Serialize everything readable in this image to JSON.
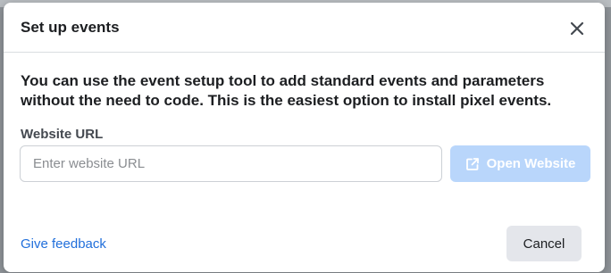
{
  "dialog": {
    "title": "Set up events",
    "description": "You can use the event setup tool to add standard events and parameters without the need to code. This is the easiest option to install pixel events.",
    "url_label": "Website URL",
    "url_placeholder": "Enter website URL",
    "url_value": "",
    "open_button_label": "Open Website",
    "open_button_enabled": false,
    "feedback_link": "Give feedback",
    "cancel_label": "Cancel"
  },
  "icons": {
    "close": "close-icon",
    "open_external": "external-link-icon"
  },
  "colors": {
    "primary_disabled": "#b9d6fb",
    "link": "#216fdb",
    "secondary_button": "#e4e6eb",
    "text": "#1c1e21"
  }
}
